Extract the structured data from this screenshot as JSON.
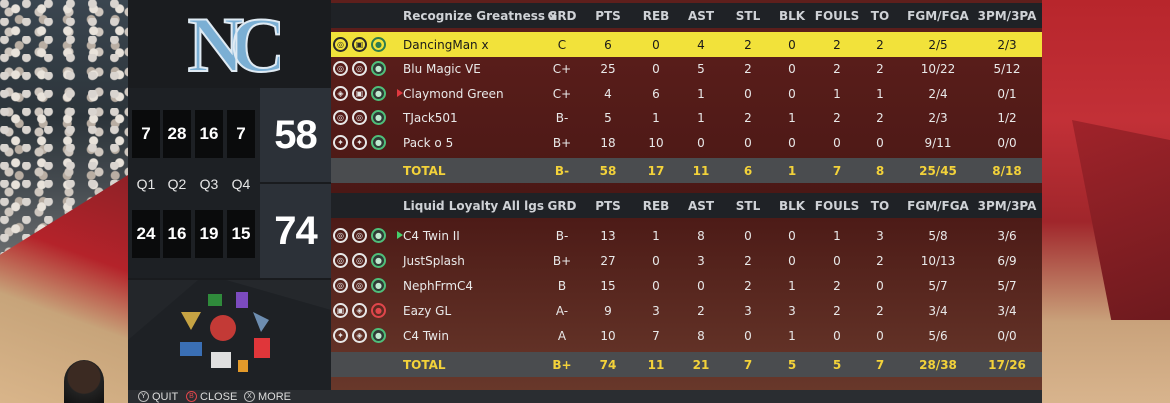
{
  "colors": {
    "highlight": "#f2e23a",
    "total_text": "#f3d23a",
    "accent_blue": "#7bafd4"
  },
  "team_logo": {
    "icon": "unc-nc-logo-icon",
    "text": "NC"
  },
  "quarters": {
    "labels": [
      "Q1",
      "Q2",
      "Q3",
      "Q4"
    ],
    "home": [
      "7",
      "28",
      "16",
      "7"
    ],
    "away": [
      "24",
      "16",
      "19",
      "15"
    ],
    "home_total": "58",
    "away_total": "74"
  },
  "columns": [
    "GRD",
    "PTS",
    "REB",
    "AST",
    "STL",
    "BLK",
    "FOULS",
    "TO",
    "FGM/FGA",
    "3PM/3PA"
  ],
  "team1": {
    "name": "Recognize Greatness x",
    "players": [
      {
        "name": "DancingMan x",
        "grd": "C",
        "pts": "6",
        "reb": "0",
        "ast": "4",
        "stl": "2",
        "blk": "0",
        "fouls": "2",
        "to": "2",
        "fg": "2/5",
        "tp": "2/3"
      },
      {
        "name": "Blu Magic VE",
        "grd": "C+",
        "pts": "25",
        "reb": "0",
        "ast": "5",
        "stl": "2",
        "blk": "0",
        "fouls": "2",
        "to": "2",
        "fg": "10/22",
        "tp": "5/12"
      },
      {
        "name": "Claymond Green",
        "grd": "C+",
        "pts": "4",
        "reb": "6",
        "ast": "1",
        "stl": "0",
        "blk": "0",
        "fouls": "1",
        "to": "1",
        "fg": "2/4",
        "tp": "0/1"
      },
      {
        "name": "TJack501",
        "grd": "B-",
        "pts": "5",
        "reb": "1",
        "ast": "1",
        "stl": "2",
        "blk": "1",
        "fouls": "2",
        "to": "2",
        "fg": "2/3",
        "tp": "1/2"
      },
      {
        "name": "Pack o 5",
        "grd": "B+",
        "pts": "18",
        "reb": "10",
        "ast": "0",
        "stl": "0",
        "blk": "0",
        "fouls": "0",
        "to": "0",
        "fg": "9/11",
        "tp": "0/0"
      }
    ],
    "total": {
      "label": "TOTAL",
      "grd": "B-",
      "pts": "58",
      "reb": "17",
      "ast": "11",
      "stl": "6",
      "blk": "1",
      "fouls": "7",
      "to": "8",
      "fg": "25/45",
      "tp": "8/18"
    }
  },
  "team2": {
    "name": "Liquid Loyalty All lgs",
    "players": [
      {
        "name": "C4 Twin II",
        "grd": "B-",
        "pts": "13",
        "reb": "1",
        "ast": "8",
        "stl": "0",
        "blk": "0",
        "fouls": "1",
        "to": "3",
        "fg": "5/8",
        "tp": "3/6"
      },
      {
        "name": "JustSplash",
        "grd": "B+",
        "pts": "27",
        "reb": "0",
        "ast": "3",
        "stl": "2",
        "blk": "0",
        "fouls": "0",
        "to": "2",
        "fg": "10/13",
        "tp": "6/9"
      },
      {
        "name": "NephFrmC4",
        "grd": "B",
        "pts": "15",
        "reb": "0",
        "ast": "0",
        "stl": "2",
        "blk": "1",
        "fouls": "2",
        "to": "0",
        "fg": "5/7",
        "tp": "5/7"
      },
      {
        "name": "Eazy GL",
        "grd": "A-",
        "pts": "9",
        "reb": "3",
        "ast": "2",
        "stl": "3",
        "blk": "3",
        "fouls": "2",
        "to": "2",
        "fg": "3/4",
        "tp": "3/4"
      },
      {
        "name": "C4 Twin",
        "grd": "A",
        "pts": "10",
        "reb": "7",
        "ast": "8",
        "stl": "0",
        "blk": "1",
        "fouls": "0",
        "to": "0",
        "fg": "5/6",
        "tp": "0/0"
      }
    ],
    "total": {
      "label": "TOTAL",
      "grd": "B+",
      "pts": "74",
      "reb": "11",
      "ast": "21",
      "stl": "7",
      "blk": "5",
      "fouls": "5",
      "to": "7",
      "fg": "28/38",
      "tp": "17/26"
    }
  },
  "footer": {
    "quit": "QUIT",
    "close": "CLOSE",
    "more": "MORE"
  }
}
